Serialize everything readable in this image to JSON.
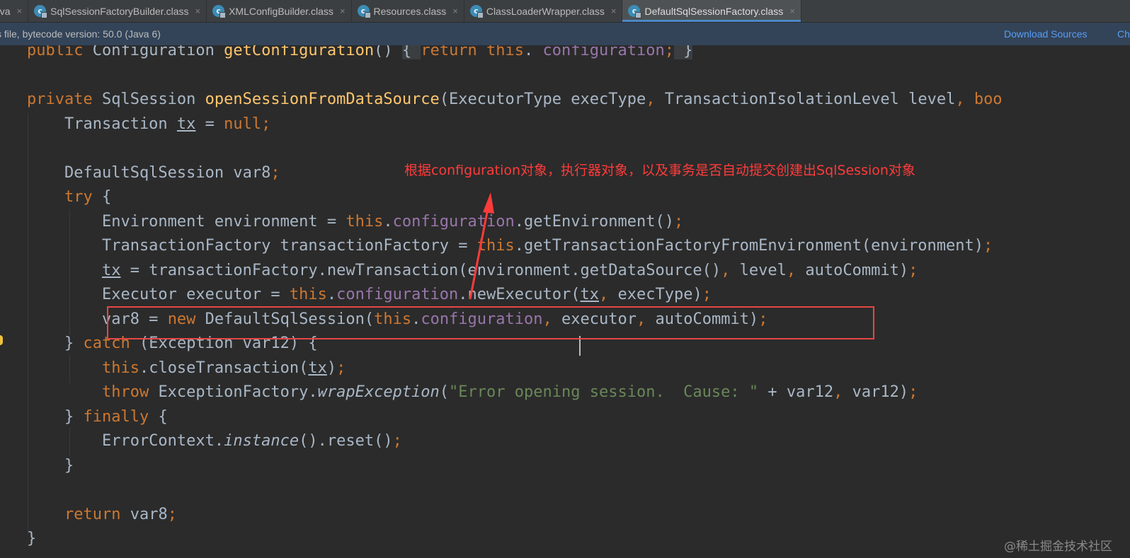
{
  "tabs": [
    {
      "label": "ava",
      "has_icon": false,
      "active": false
    },
    {
      "label": "SqlSessionFactoryBuilder.class",
      "has_icon": true,
      "active": false
    },
    {
      "label": "XMLConfigBuilder.class",
      "has_icon": true,
      "active": false
    },
    {
      "label": "Resources.class",
      "has_icon": true,
      "active": false
    },
    {
      "label": "ClassLoaderWrapper.class",
      "has_icon": true,
      "active": false
    },
    {
      "label": "DefaultSqlSessionFactory.class",
      "has_icon": true,
      "active": true
    }
  ],
  "tab_icon_letter": "c",
  "tab_close_glyph": "×",
  "notice": {
    "text": "s file, bytecode version: 50.0 (Java 6)",
    "download_sources": "Download Sources",
    "choose_sources": "Ch"
  },
  "code_lines": [
    [
      [
        "kw",
        "public "
      ],
      [
        "",
        "Configuration "
      ],
      [
        "fn",
        "getConfiguration"
      ],
      [
        "",
        "() "
      ],
      [
        "hl",
        "{ "
      ],
      [
        "kw",
        "return this"
      ],
      [
        "",
        ". "
      ],
      [
        "fld",
        "configuration"
      ],
      [
        "kw",
        ";"
      ],
      [
        "hl",
        " }"
      ]
    ],
    [],
    [
      [
        "kw",
        "private "
      ],
      [
        "",
        "SqlSession "
      ],
      [
        "fn",
        "openSessionFromDataSource"
      ],
      [
        "",
        "(ExecutorType execType"
      ],
      [
        "kw",
        ", "
      ],
      [
        "",
        "TransactionIsolationLevel level"
      ],
      [
        "kw",
        ", boo"
      ]
    ],
    [
      [
        "",
        "    Transaction "
      ],
      [
        "ul",
        "tx"
      ],
      [
        "",
        " = "
      ],
      [
        "kw",
        "null;"
      ]
    ],
    [],
    [
      [
        "",
        "    DefaultSqlSession var8"
      ],
      [
        "kw",
        ";"
      ]
    ],
    [
      [
        "kw",
        "    try "
      ],
      [
        "",
        "{"
      ]
    ],
    [
      [
        "",
        "        Environment environment = "
      ],
      [
        "kw",
        "this"
      ],
      [
        "",
        "."
      ],
      [
        "fld",
        "configuration"
      ],
      [
        "",
        ".getEnvironment()"
      ],
      [
        "kw",
        ";"
      ]
    ],
    [
      [
        "",
        "        TransactionFactory transactionFactory = "
      ],
      [
        "kw",
        "this"
      ],
      [
        "",
        ".getTransactionFactoryFromEnvironment(environment)"
      ],
      [
        "kw",
        ";"
      ]
    ],
    [
      [
        "",
        "        "
      ],
      [
        "ul",
        "tx"
      ],
      [
        "",
        " = transactionFactory.newTransaction(environment.getDataSource()"
      ],
      [
        "kw",
        ", "
      ],
      [
        "",
        "level"
      ],
      [
        "kw",
        ", "
      ],
      [
        "",
        "autoCommit)"
      ],
      [
        "kw",
        ";"
      ]
    ],
    [
      [
        "",
        "        Executor executor = "
      ],
      [
        "kw",
        "this"
      ],
      [
        "",
        "."
      ],
      [
        "fld",
        "configuration"
      ],
      [
        "",
        ".newExecutor("
      ],
      [
        "ul",
        "tx"
      ],
      [
        "kw",
        ", "
      ],
      [
        "",
        "execType)"
      ],
      [
        "kw",
        ";"
      ]
    ],
    [
      [
        "",
        "        var8 = "
      ],
      [
        "kw",
        "new "
      ],
      [
        "",
        "DefaultSqlSession("
      ],
      [
        "kw",
        "this"
      ],
      [
        "",
        "."
      ],
      [
        "fld",
        "configuration"
      ],
      [
        "kw",
        ", "
      ],
      [
        "",
        "executor"
      ],
      [
        "kw",
        ", "
      ],
      [
        "",
        "autoCommit)"
      ],
      [
        "kw",
        ";"
      ]
    ],
    [
      [
        "",
        "    } "
      ],
      [
        "kw",
        "catch "
      ],
      [
        "",
        "(Exception var12) {"
      ]
    ],
    [
      [
        "kw",
        "        this"
      ],
      [
        "",
        ".closeTransaction("
      ],
      [
        "ul",
        "tx"
      ],
      [
        "",
        ")"
      ],
      [
        "kw",
        ";"
      ]
    ],
    [
      [
        "kw",
        "        throw "
      ],
      [
        "",
        "ExceptionFactory."
      ],
      [
        "it",
        "wrapException"
      ],
      [
        "",
        "("
      ],
      [
        "str",
        "\"Error opening session.  Cause: \""
      ],
      [
        "",
        " + var12"
      ],
      [
        "kw",
        ", "
      ],
      [
        "",
        "var12)"
      ],
      [
        "kw",
        ";"
      ]
    ],
    [
      [
        "",
        "    } "
      ],
      [
        "kw",
        "finally "
      ],
      [
        "",
        "{"
      ]
    ],
    [
      [
        "",
        "        ErrorContext."
      ],
      [
        "it",
        "instance"
      ],
      [
        "",
        "().reset()"
      ],
      [
        "kw",
        ";"
      ]
    ],
    [
      [
        "",
        "    }"
      ]
    ],
    [],
    [
      [
        "kw",
        "    return "
      ],
      [
        "",
        "var8"
      ],
      [
        "kw",
        ";"
      ]
    ],
    [
      [
        "",
        "}"
      ]
    ]
  ],
  "annotation": "根据configuration对象，执行器对象，以及事务是否自动提交创建出SqlSession对象",
  "watermark": "@稀土掘金技术社区",
  "colors": {
    "keyword": "#cc7832",
    "field": "#9876aa",
    "method": "#ffc66d",
    "string": "#6a8759",
    "default": "#a9b7c6",
    "annotation": "#ff3b3b",
    "background": "#2b2b2b"
  }
}
